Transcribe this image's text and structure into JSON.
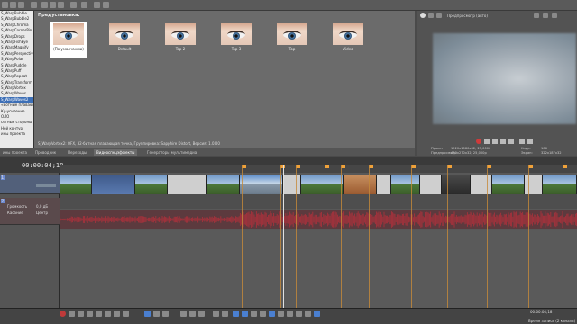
{
  "fx_list": {
    "items": [
      "S_WarpBubble",
      "S_WarpBubble2",
      "S_WarpChroma",
      "S_WarpCornerPin",
      "S_WarpDrops",
      "S_WarpFishEye",
      "S_WarpMagnify",
      "S_WarpPerspective",
      "S_WarpPolar",
      "S_WarpPuddle",
      "S_WarpPuff",
      "S_WarpRepeat",
      "S_WarpTransform",
      "S_WarpVortex",
      "S_WarpWaves",
      "S_WarpWaves2"
    ],
    "selected_index": 15,
    "bottom_items": [
      "«Ботные плавающие",
      "Ку-усиление",
      "ОЛО",
      "сетные стороны",
      "Ней контур",
      "ины проекта"
    ]
  },
  "presets": {
    "label": "Предустановка:",
    "items": [
      "(По умолчанию)",
      "Default",
      "Top 2",
      "Top 3",
      "Top",
      "Video"
    ],
    "selected_index": 0,
    "description": "S_WarpVortex2: OFX, 32-битная плавающая точка, Группировка: Sapphire Distort, Версия: 1.0.00"
  },
  "tabs": [
    "ины проекта",
    "Проводник",
    "Переходы",
    "Видеоспецэффекты",
    "Генераторы мультимедиа"
  ],
  "tabs_active": 3,
  "preview": {
    "mode": "Предпросмотр (авто)",
    "info_left": [
      "Проект:",
      "Предпросмотр:"
    ],
    "info_left_values": [
      "1920x1080x32; 25,000i",
      "480x270x32; 25,000p"
    ],
    "info_right": [
      "Кадр:",
      "Экран:"
    ],
    "info_right_values": [
      "106",
      "322x187x32"
    ]
  },
  "timeline": {
    "timecode": "00:00:04;18",
    "bottom_time": "00:00:04;18",
    "status": "Время записи (2 канала)"
  },
  "tracks": {
    "video_num": "1",
    "audio_num": "2",
    "audio_level": "Громкость",
    "audio_vol": "0,0 дБ",
    "pan_label": "Касание",
    "pan_value": "Центр"
  }
}
